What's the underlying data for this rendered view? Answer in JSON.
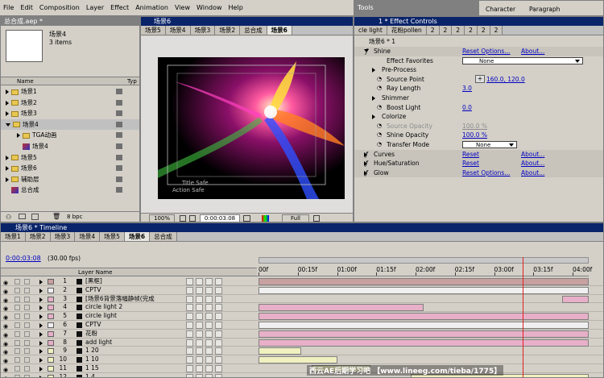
{
  "menu": [
    "File",
    "Edit",
    "Composition",
    "Layer",
    "Effect",
    "Animation",
    "View",
    "Window",
    "Help"
  ],
  "project": {
    "title": "总合成.aep *",
    "preview_name": "场景4",
    "preview_items": "3 items",
    "col_name": "Name",
    "col_type": "Typ",
    "items": [
      "场景1",
      "场景2",
      "场景3",
      "场景4",
      "TGA动画",
      "场景4",
      "场景5",
      "场景6",
      "辅助层",
      "总合成"
    ],
    "bpc": "8 bpc"
  },
  "comp": {
    "title": "场景6",
    "tabs": [
      "场景5",
      "场景4",
      "场景3",
      "场景2",
      "总合成",
      "场景6"
    ],
    "title_safe": "Title Safe",
    "action_safe": "Action Safe",
    "zoom": "100%",
    "time": "0:00:03:08",
    "res": "Full"
  },
  "tools": {
    "tab": "Tools"
  },
  "character": {
    "tabs": [
      "Character",
      "Paragraph"
    ]
  },
  "fx": {
    "title": "1 * Effect Controls",
    "tabs": [
      "cle light",
      "花粉pollen",
      "2",
      "2",
      "2",
      "2",
      "2",
      "2"
    ],
    "layer_title": "场景6 * 1",
    "rows": [
      {
        "label": "Shine",
        "v1": "Reset Options...",
        "v2": "About..."
      },
      {
        "label": "Effect Favorites",
        "dd": "None"
      },
      {
        "label": "Pre-Process"
      },
      {
        "label": "Source Point",
        "v1": "160.0, 120.0"
      },
      {
        "label": "Ray Length",
        "v1": "3.0"
      },
      {
        "label": "Shimmer"
      },
      {
        "label": "Boost Light",
        "v1": "0.0"
      },
      {
        "label": "Colorize"
      },
      {
        "label": "Source Opacity",
        "v1": "100.0 %"
      },
      {
        "label": "Shine Opacity",
        "v1": "100.0 %"
      },
      {
        "label": "Transfer Mode",
        "dd": "None"
      },
      {
        "label": "Curves",
        "v1": "Reset",
        "v2": "About..."
      },
      {
        "label": "Hue/Saturation",
        "v1": "Reset",
        "v2": "About..."
      },
      {
        "label": "Glow",
        "v1": "Reset Options...",
        "v2": "About..."
      }
    ]
  },
  "timeline": {
    "title": "场景6 * Timeline",
    "tabs": [
      "场景1",
      "场景2",
      "场景3",
      "场景4",
      "场景5",
      "场景6",
      "总合成"
    ],
    "current_time": "0:00:03:08",
    "fps": "(30.00 fps)",
    "col_layer_name": "Layer Name",
    "ruler": [
      "00f",
      "00:15f",
      "01:00f",
      "01:15f",
      "02:00f",
      "02:15f",
      "03:00f",
      "03:15f",
      "04:00f"
    ],
    "layers": [
      {
        "num": "1",
        "name": "[黑框]",
        "color": "#c8a0a0",
        "bar_start": 0,
        "bar_end": 1
      },
      {
        "num": "2",
        "name": "CPTV",
        "color": "#f0f0f0",
        "bar_start": 0,
        "bar_end": 1
      },
      {
        "num": "3",
        "name": "[场景6背景落幅静帧(完成",
        "color": "#e8b0c8",
        "bar_start": 0.92,
        "bar_end": 1
      },
      {
        "num": "4",
        "name": "circle light 2",
        "color": "#e8b0c8",
        "bar_start": 0,
        "bar_end": 0.5
      },
      {
        "num": "5",
        "name": "circle light",
        "color": "#e8b0c8",
        "bar_start": 0,
        "bar_end": 1
      },
      {
        "num": "6",
        "name": "CPTV",
        "color": "#f0f0f0",
        "bar_start": 0,
        "bar_end": 1
      },
      {
        "num": "7",
        "name": "花粉",
        "color": "#e8b0c8",
        "bar_start": 0,
        "bar_end": 1
      },
      {
        "num": "8",
        "name": "add light",
        "color": "#e8b0c8",
        "bar_start": 0,
        "bar_end": 1
      },
      {
        "num": "9",
        "name": "1 20",
        "color": "#f0f0c0",
        "bar_start": 0,
        "bar_end": 0.13
      },
      {
        "num": "10",
        "name": "1 10",
        "color": "#f0f0c0",
        "bar_start": 0,
        "bar_end": 0.24
      },
      {
        "num": "11",
        "name": "1 15",
        "color": "#f0f0c0",
        "bar_start": 0.16,
        "bar_end": 0.34
      },
      {
        "num": "12",
        "name": "1 4",
        "color": "#f0f0c0",
        "bar_start": 0.46,
        "bar_end": 1
      }
    ],
    "playhead": 0.8
  },
  "watermark": "西云AE后期学习吧 【www.lineeg.com/tieba/1775】"
}
